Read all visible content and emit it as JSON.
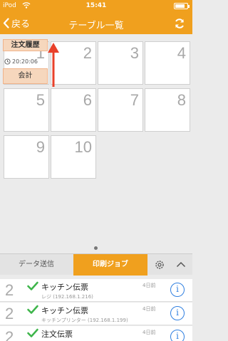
{
  "status_bar": {
    "carrier": "iPod",
    "time": "15:41",
    "battery_level": 0.8
  },
  "nav": {
    "back_label": "戻る",
    "title": "テーブル一覧"
  },
  "tables": [
    "1",
    "2",
    "3",
    "4",
    "5",
    "6",
    "7",
    "8",
    "9",
    "10"
  ],
  "table1_overlay": {
    "history_label": "注文履歴",
    "time": "20:20:06",
    "checkout_label": "会計"
  },
  "bottom_tabs": {
    "data_send": "データ送信",
    "print_job": "印刷ジョブ"
  },
  "print_jobs": [
    {
      "count": "2",
      "title": "キッチン伝票",
      "printer": "レジ (192.168.1.216)",
      "ago": "4日前"
    },
    {
      "count": "2",
      "title": "キッチン伝票",
      "printer": "キッチンプリンター (192.168.1.199)",
      "ago": "4日前"
    },
    {
      "count": "2",
      "title": "注文伝票",
      "printer": "",
      "ago": "4日前"
    }
  ],
  "colors": {
    "accent": "#f0a01e",
    "info": "#2f7fe0",
    "check": "#3db54a",
    "arrow": "#e8402a"
  }
}
